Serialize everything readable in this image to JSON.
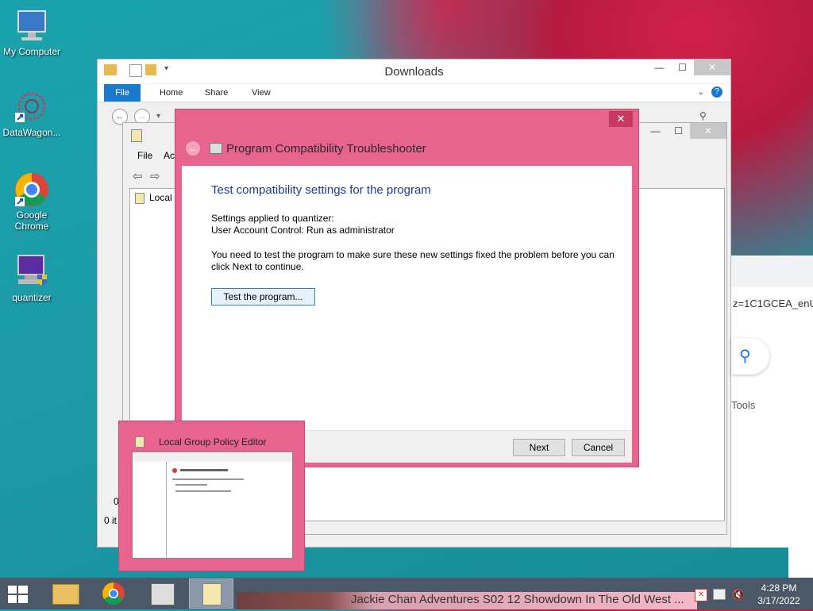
{
  "desktop": {
    "icons": [
      {
        "label": "My Computer",
        "icon": "monitor-icon"
      },
      {
        "label": "DataWagon...",
        "icon": "data-app-icon"
      },
      {
        "label": "Google Chrome",
        "icon": "chrome-icon"
      },
      {
        "label": "quantizer",
        "icon": "shield-app-icon"
      }
    ]
  },
  "explorer": {
    "title": "Downloads",
    "tabs": [
      "File",
      "Home",
      "Share",
      "View"
    ],
    "status": "0 it",
    "side_label": "0"
  },
  "gpe": {
    "menu": [
      "File",
      "Ac"
    ],
    "tree_item": "Local"
  },
  "dialog": {
    "window_title": "Program Compatibility Troubleshooter",
    "heading": "Test compatibility settings for the program",
    "settings_line1": "Settings applied to quantizer:",
    "settings_line2": "User Account Control:  Run as administrator",
    "info_line1": "You need to test the program to make sure these new settings fixed the problem before you can",
    "info_line2": "click Next to continue.",
    "test_button": "Test the program...",
    "next_button": "Next",
    "cancel_button": "Cancel",
    "close_glyph": "✕"
  },
  "thumbnail": {
    "title": "Local Group Policy Editor"
  },
  "browser": {
    "url_fragment": "z=1C1GCEA_enU",
    "tools_label": "Tools"
  },
  "taskbar": {
    "media_title": "Jackie Chan Adventures S02 12 Showdown In The Old West ...",
    "time": "4:28 PM",
    "date": "3/17/2022"
  },
  "colors": {
    "accent_pink": "#e7648f",
    "file_tab_blue": "#1979ca",
    "heading_blue": "#1e3a8a"
  }
}
